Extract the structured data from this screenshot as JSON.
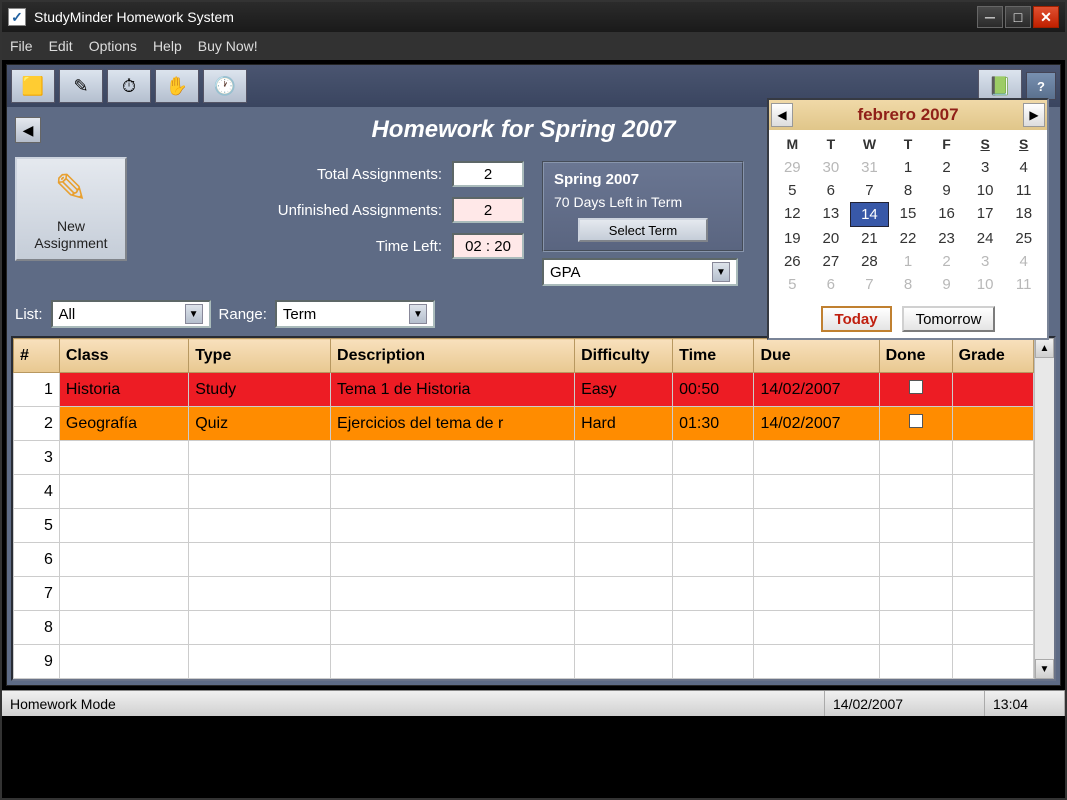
{
  "window": {
    "title": "StudyMinder Homework System"
  },
  "menu": {
    "items": [
      "File",
      "Edit",
      "Options",
      "Help",
      "Buy Now!"
    ]
  },
  "toolbar": {
    "icons": [
      "note-icon",
      "pencil-icon",
      "stopwatch-icon",
      "hand-icon",
      "clock-icon"
    ],
    "book_icon": "book-icon",
    "help": "?"
  },
  "header": {
    "title": "Homework for Spring 2007"
  },
  "new_assignment": {
    "label": "New\nAssignment"
  },
  "stats": {
    "total_label": "Total Assignments:",
    "total_value": "2",
    "unfinished_label": "Unfinished Assignments:",
    "unfinished_value": "2",
    "timeleft_label": "Time Left:",
    "timeleft_value": "02 : 20"
  },
  "term": {
    "name": "Spring 2007",
    "days_left": "70 Days Left in Term",
    "select_btn": "Select Term",
    "gpa_label": "GPA"
  },
  "filters": {
    "list_label": "List:",
    "list_value": "All",
    "range_label": "Range:",
    "range_value": "Term"
  },
  "calendar": {
    "title": "febrero 2007",
    "dow": [
      "M",
      "T",
      "W",
      "T",
      "F",
      "S",
      "S"
    ],
    "weeks": [
      [
        {
          "d": "29",
          "g": true
        },
        {
          "d": "30",
          "g": true
        },
        {
          "d": "31",
          "g": true
        },
        {
          "d": "1"
        },
        {
          "d": "2"
        },
        {
          "d": "3"
        },
        {
          "d": "4"
        }
      ],
      [
        {
          "d": "5"
        },
        {
          "d": "6"
        },
        {
          "d": "7"
        },
        {
          "d": "8"
        },
        {
          "d": "9"
        },
        {
          "d": "10"
        },
        {
          "d": "11"
        }
      ],
      [
        {
          "d": "12"
        },
        {
          "d": "13"
        },
        {
          "d": "14",
          "t": true
        },
        {
          "d": "15"
        },
        {
          "d": "16"
        },
        {
          "d": "17"
        },
        {
          "d": "18"
        }
      ],
      [
        {
          "d": "19"
        },
        {
          "d": "20"
        },
        {
          "d": "21"
        },
        {
          "d": "22"
        },
        {
          "d": "23"
        },
        {
          "d": "24"
        },
        {
          "d": "25"
        }
      ],
      [
        {
          "d": "26"
        },
        {
          "d": "27"
        },
        {
          "d": "28"
        },
        {
          "d": "1",
          "g": true
        },
        {
          "d": "2",
          "g": true
        },
        {
          "d": "3",
          "g": true
        },
        {
          "d": "4",
          "g": true
        }
      ],
      [
        {
          "d": "5",
          "g": true
        },
        {
          "d": "6",
          "g": true
        },
        {
          "d": "7",
          "g": true
        },
        {
          "d": "8",
          "g": true
        },
        {
          "d": "9",
          "g": true
        },
        {
          "d": "10",
          "g": true
        },
        {
          "d": "11",
          "g": true
        }
      ]
    ],
    "today_btn": "Today",
    "tomorrow_btn": "Tomorrow"
  },
  "table": {
    "headers": [
      "#",
      "Class",
      "Type",
      "Description",
      "Difficulty",
      "Time",
      "Due",
      "Done",
      "Grade"
    ],
    "rows": [
      {
        "num": "1",
        "class": "Historia",
        "type": "Study",
        "desc": "Tema 1 de Historia",
        "diff": "Easy",
        "time": "00:50",
        "due": "14/02/2007",
        "done": false,
        "grade": "",
        "color": "red"
      },
      {
        "num": "2",
        "class": "Geografía",
        "type": "Quiz",
        "desc": "Ejercicios del tema de r",
        "diff": "Hard",
        "time": "01:30",
        "due": "14/02/2007",
        "done": false,
        "grade": "",
        "color": "orange"
      }
    ],
    "empty_count": 7
  },
  "statusbar": {
    "mode": "Homework Mode",
    "date": "14/02/2007",
    "time": "13:04"
  }
}
